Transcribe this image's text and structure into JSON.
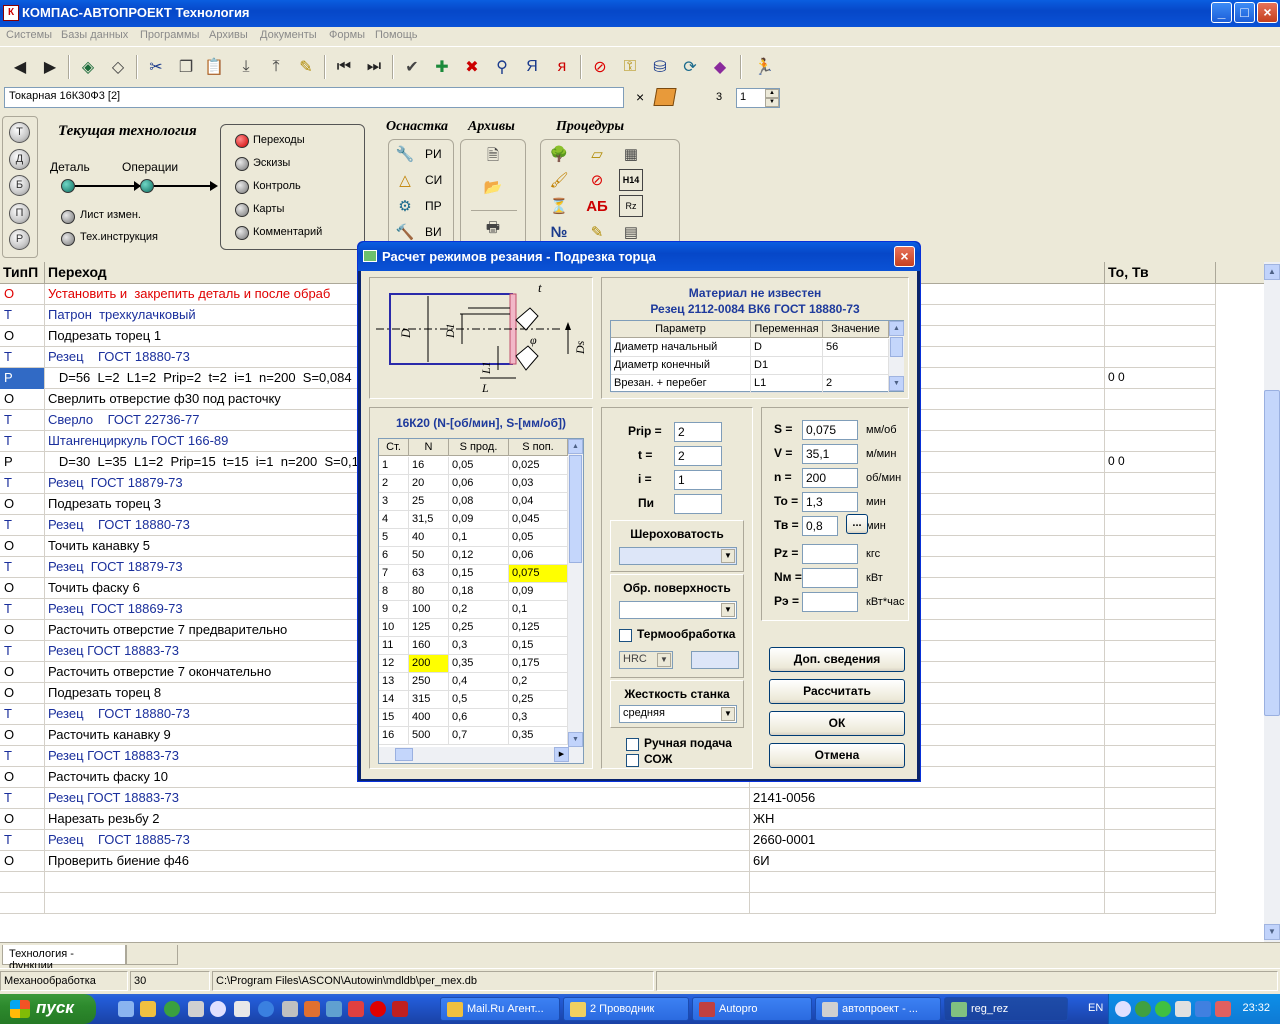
{
  "window": {
    "title": "КОМПАС-АВТОПРОЕКТ Технология",
    "buttons": [
      "_",
      "□",
      "×"
    ]
  },
  "menu": [
    "Системы",
    "Базы данных",
    "Программы",
    "Архивы",
    "Документы",
    "Формы",
    "Помощь"
  ],
  "selector": {
    "machine": "Токарная 16К30Ф3  [2]",
    "x": "×",
    "number_label": "3",
    "spinner_value": "1"
  },
  "techpanel": {
    "side_buttons": [
      "Т",
      "Д",
      "Б",
      "П",
      "Р"
    ],
    "current_title": "Текущая технология",
    "flow_left": "Деталь",
    "flow_right": "Операции",
    "extras": [
      "Лист измен.",
      "Тех.инструкция"
    ],
    "modes": [
      "Переходы",
      "Эскизы",
      "Контроль",
      "Карты",
      "Комментарий"
    ],
    "osnastka_title": "Оснастка",
    "archives_title": "Архивы",
    "procedures_title": "Процедуры",
    "osnastka_items": [
      "РИ",
      "СИ",
      "ПР",
      "ВИ"
    ],
    "proc_icons": [
      "Н14",
      "Rz"
    ]
  },
  "grid": {
    "headers": [
      "ТипП",
      "Переход",
      "",
      "То, Тв"
    ],
    "rows": [
      {
        "type": "О",
        "text": "Установить и  закрепить деталь и после обраб",
        "col3": "",
        "col4": "",
        "style": "red"
      },
      {
        "type": "Т",
        "text": "Патрон  трехкулачковый",
        "col3": "",
        "col4": "",
        "style": "T"
      },
      {
        "type": "О",
        "text": "Подрезать торец 1",
        "col3": "",
        "col4": "",
        "style": "O"
      },
      {
        "type": "Т",
        "text": "Резец    ГОСТ 18880-73",
        "col3": "",
        "col4": "",
        "style": "T"
      },
      {
        "type": "Р",
        "text": "   D=56  L=2  L1=2  Prip=2  t=2  i=1  n=200  S=0,084  To",
        "col3": "",
        "col4": "0 0",
        "style": "P",
        "selected": true
      },
      {
        "type": "О",
        "text": "Сверлить отверстие ф30 под расточку",
        "col3": "",
        "col4": "",
        "style": "O"
      },
      {
        "type": "Т",
        "text": "Сверло    ГОСТ 22736-77",
        "col3": "",
        "col4": "",
        "style": "T"
      },
      {
        "type": "Т",
        "text": "Штангенциркуль ГОСТ 166-89",
        "col3": "",
        "col4": "",
        "style": "T"
      },
      {
        "type": "Р",
        "text": "   D=30  L=35  L1=2  Prip=15  t=15  i=1  n=200  S=0,1  Tc",
        "col3": "",
        "col4": "0 0",
        "style": "P"
      },
      {
        "type": "Т",
        "text": "Резец  ГОСТ 18879-73",
        "col3": "",
        "col4": "",
        "style": "T"
      },
      {
        "type": "О",
        "text": "Подрезать торец 3",
        "col3": "",
        "col4": "",
        "style": "O"
      },
      {
        "type": "Т",
        "text": "Резец    ГОСТ 18880-73",
        "col3": "",
        "col4": "",
        "style": "T"
      },
      {
        "type": "О",
        "text": "Точить канавку 5",
        "col3": "",
        "col4": "",
        "style": "O"
      },
      {
        "type": "Т",
        "text": "Резец  ГОСТ 18879-73",
        "col3": "",
        "col4": "",
        "style": "T"
      },
      {
        "type": "О",
        "text": "Точить фаску 6",
        "col3": "",
        "col4": "",
        "style": "O"
      },
      {
        "type": "Т",
        "text": "Резец  ГОСТ 18869-73",
        "col3": "",
        "col4": "",
        "style": "T"
      },
      {
        "type": "О",
        "text": "Расточить отверстие 7 предварительно",
        "col3": "",
        "col4": "",
        "style": "O"
      },
      {
        "type": "Т",
        "text": "Резец ГОСТ 18883-73",
        "col3": "",
        "col4": "",
        "style": "T"
      },
      {
        "type": "О",
        "text": "Расточить отверстие 7 окончательно",
        "col3": "",
        "col4": "",
        "style": "O"
      },
      {
        "type": "О",
        "text": "Подрезать торец 8",
        "col3": "",
        "col4": "",
        "style": "O"
      },
      {
        "type": "Т",
        "text": "Резец    ГОСТ 18880-73",
        "col3": "",
        "col4": "",
        "style": "T"
      },
      {
        "type": "О",
        "text": "Расточить канавку 9",
        "col3": "",
        "col4": "",
        "style": "O"
      },
      {
        "type": "Т",
        "text": "Резец ГОСТ 18883-73",
        "col3": "",
        "col4": "",
        "style": "T"
      },
      {
        "type": "О",
        "text": "Расточить фаску 10",
        "col3": "",
        "col4": "",
        "style": "O"
      },
      {
        "type": "Т",
        "text": "Резец ГОСТ 18883-73",
        "col3": "2141-0056",
        "col4": "",
        "style": "T"
      },
      {
        "type": "О",
        "text": "Нарезать резьбу 2",
        "col3": "ЖН",
        "col4": "",
        "style": "O"
      },
      {
        "type": "Т",
        "text": "Резец    ГОСТ 18885-73",
        "col3": "2660-0001",
        "col4": "",
        "style": "T"
      },
      {
        "type": "О",
        "text": "Проверить биение ф46",
        "col3": "6И",
        "col4": "",
        "style": "O"
      },
      {
        "type": "",
        "text": "",
        "col3": "",
        "col4": "",
        "style": "O"
      },
      {
        "type": "",
        "text": "",
        "col3": "",
        "col4": "",
        "style": "O"
      }
    ]
  },
  "bottom": {
    "tab1": "Технология - функции",
    "tab2": ""
  },
  "status": {
    "mode": "Механообработка",
    "num": "30",
    "path": "C:\\Program Files\\ASCON\\Autowin\\mdldb\\per_mex.db"
  },
  "taskbar": {
    "start": "пуск",
    "tasks": [
      "Mail.Ru Агент...",
      "2 Проводник",
      "Autopro",
      "автопроект - ...",
      "reg_rez"
    ],
    "lang": "EN",
    "clock": "23:32"
  },
  "dialog": {
    "title": "Расчет режимов резания - Подрезка торца",
    "material_line1": "Материал не известен",
    "material_line2": "Резец 2112-0084 ВК6 ГОСТ 18880-73",
    "param_headers": [
      "Параметр",
      "Переменная",
      "Значение"
    ],
    "params": [
      {
        "name": "Диаметр начальный",
        "var": "D",
        "val": "56"
      },
      {
        "name": "Диаметр конечный",
        "var": "D1",
        "val": ""
      },
      {
        "name": "Врезан. + перебег",
        "var": "L1",
        "val": "2"
      }
    ],
    "machine_head": "16К20 (N-[об/мин], S-[мм/об])",
    "speed_headers": [
      "Ст.",
      "N",
      "S прод.",
      "S поп."
    ],
    "speed_rows": [
      [
        "1",
        "16",
        "0,05",
        "0,025"
      ],
      [
        "2",
        "20",
        "0,06",
        "0,03"
      ],
      [
        "3",
        "25",
        "0,08",
        "0,04"
      ],
      [
        "4",
        "31,5",
        "0,09",
        "0,045"
      ],
      [
        "5",
        "40",
        "0,1",
        "0,05"
      ],
      [
        "6",
        "50",
        "0,12",
        "0,06"
      ],
      [
        "7",
        "63",
        "0,15",
        "0,075"
      ],
      [
        "8",
        "80",
        "0,18",
        "0,09"
      ],
      [
        "9",
        "100",
        "0,2",
        "0,1"
      ],
      [
        "10",
        "125",
        "0,25",
        "0,125"
      ],
      [
        "11",
        "160",
        "0,3",
        "0,15"
      ],
      [
        "12",
        "200",
        "0,35",
        "0,175"
      ],
      [
        "13",
        "250",
        "0,4",
        "0,2"
      ],
      [
        "14",
        "315",
        "0,5",
        "0,25"
      ],
      [
        "15",
        "400",
        "0,6",
        "0,3"
      ],
      [
        "16",
        "500",
        "0,7",
        "0,35"
      ]
    ],
    "prip_label": "Prip =",
    "prip": "2",
    "t_label": "t =",
    "t": "2",
    "i_label": "i =",
    "i": "1",
    "pi_label": "Пи",
    "pi": "",
    "roughness_label": "Шероховатость",
    "surface_label": "Обр. поверхность",
    "thermo_label": "Термообработка",
    "hrc": "HRC",
    "rigidity_label": "Жесткость станка",
    "rigidity_value": "средняя",
    "manual_feed": "Ручная подача",
    "coolant": "СОЖ",
    "right_fields": [
      {
        "label": "S =",
        "value": "0,075",
        "unit": "мм/об"
      },
      {
        "label": "V =",
        "value": "35,1",
        "unit": "м/мин"
      },
      {
        "label": "n =",
        "value": "200",
        "unit": "об/мин"
      },
      {
        "label": "To =",
        "value": "1,3",
        "unit": "мин"
      },
      {
        "label": "Тв =",
        "value": "0,8",
        "unit": "мин"
      },
      {
        "label": "Pz =",
        "value": "",
        "unit": "кгс"
      },
      {
        "label": "Nм =",
        "value": "",
        "unit": "кВт"
      },
      {
        "label": "Рэ =",
        "value": "",
        "unit": "кВт*час"
      }
    ],
    "ellipsis": "...",
    "btn_info": "Доп. сведения",
    "btn_calc": "Рассчитать",
    "btn_ok": "ОК",
    "btn_cancel": "Отмена",
    "sketch_labels": [
      "t",
      "D",
      "D1",
      "L1",
      "L",
      "φ",
      "Ds"
    ]
  }
}
